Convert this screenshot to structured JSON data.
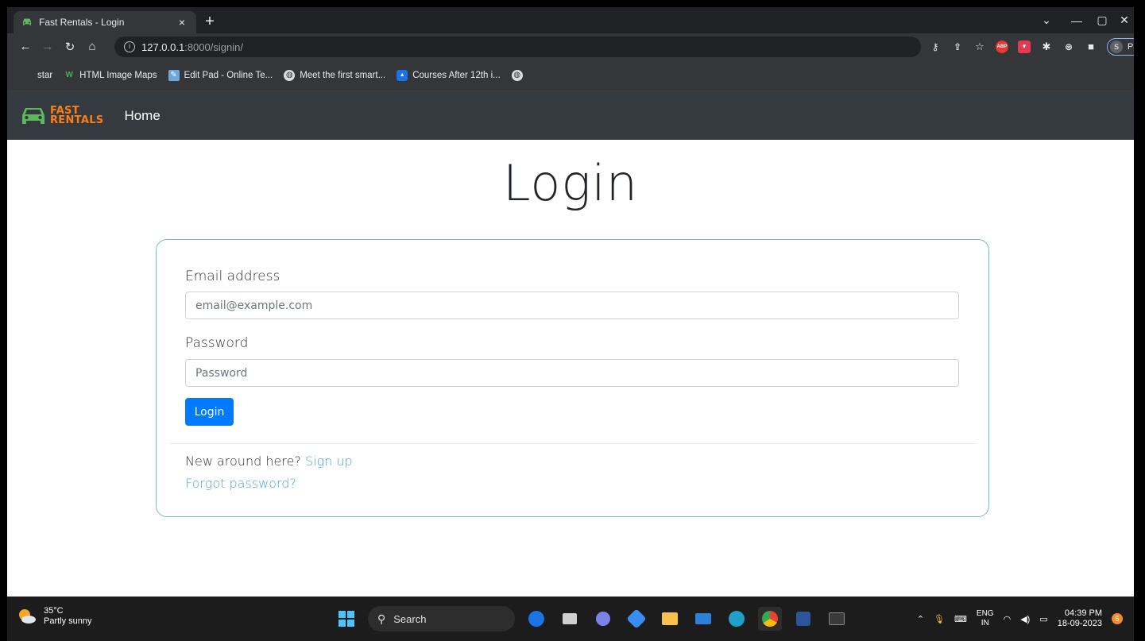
{
  "browser": {
    "tab_title": "Fast Rentals - Login",
    "tab_close": "×",
    "new_tab": "+",
    "url_host": "127.0.0.1",
    "url_path": ":8000/signin/",
    "profile_initial": "S",
    "profile_status": "Paused",
    "extension_abp": "ABP",
    "bookmarks": [
      {
        "label": "star"
      },
      {
        "label": "HTML Image Maps"
      },
      {
        "label": "Edit Pad - Online Te..."
      },
      {
        "label": "Meet the first smart..."
      },
      {
        "label": "Courses After 12th i..."
      },
      {
        "label": ""
      }
    ]
  },
  "app": {
    "brand_line1": "FAST",
    "brand_line2": "RENTALS",
    "nav_home": "Home",
    "page_title": "Login",
    "email_label": "Email address",
    "email_placeholder": "email@example.com",
    "password_label": "Password",
    "password_placeholder": "Password",
    "login_button": "Login",
    "new_around": "New around here?",
    "sign_up": "Sign up",
    "forgot_password": "Forgot password?"
  },
  "taskbar": {
    "temperature": "35°C",
    "weather": "Partly sunny",
    "search_label": "Search",
    "lang_top": "ENG",
    "lang_bottom": "IN",
    "time": "04:39 PM",
    "date": "18-09-2023",
    "notification_count": "5"
  },
  "colors": {
    "accent": "#007bff",
    "brand_orange": "#fd7e14",
    "brand_green": "#5cb85c",
    "navbar": "#343a40",
    "card_border": "#74b9d8",
    "link": "#4aa3df"
  }
}
